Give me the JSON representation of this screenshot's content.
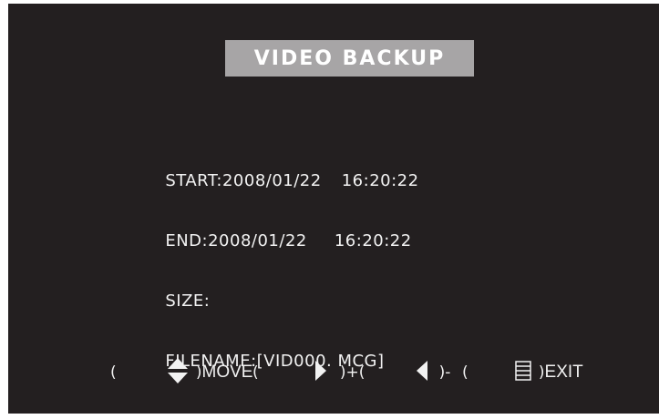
{
  "title": "VIDEO BACKUP",
  "fields": {
    "start_label": "START:",
    "start_date": "2008/01/22",
    "start_time": "16:20:22",
    "end_label": "END:",
    "end_date": "2008/01/22",
    "end_time": "16:20:22",
    "size_label": "SIZE:",
    "filename_label": "FILENAME:",
    "filename_value": "[VID000. MCG]"
  },
  "footer": {
    "move_open": "(",
    "move_close": ")",
    "move_label": "MOVE",
    "plus_open": "(",
    "plus_close": ")+(",
    "minus_close": ")-",
    "exit_open": "(",
    "exit_close": ")",
    "exit_label": "EXIT",
    "icons": [
      "up-down-arrow-icon",
      "right-arrow-icon",
      "left-arrow-icon",
      "menu-icon"
    ]
  },
  "colors": {
    "background": "#231f20",
    "title_box": "#a7a5a6",
    "text": "#f2f2f2"
  }
}
